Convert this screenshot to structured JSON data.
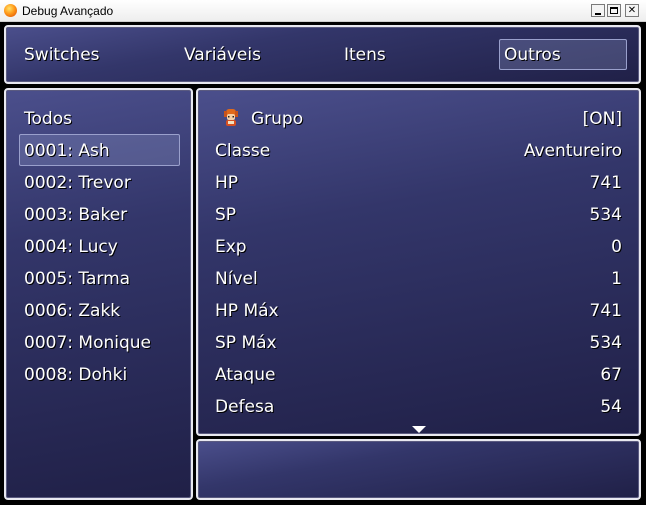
{
  "window": {
    "title": "Debug Avançado"
  },
  "menu": {
    "items": [
      "Switches",
      "Variáveis",
      "Itens",
      "Outros"
    ],
    "selected": "Outros"
  },
  "sidebar": {
    "items": [
      "Todos",
      "0001: Ash",
      "0002: Trevor",
      "0003: Baker",
      "0004: Lucy",
      "0005: Tarma",
      "0006: Zakk",
      "0007: Monique",
      "0008: Dohki"
    ],
    "selected": "0001: Ash"
  },
  "detail": {
    "group": {
      "label": "Grupo",
      "value": "[ON]"
    },
    "rows": [
      {
        "label": "Classe",
        "value": "Aventureiro"
      },
      {
        "label": "HP",
        "value": "741"
      },
      {
        "label": "SP",
        "value": "534"
      },
      {
        "label": "Exp",
        "value": "0"
      },
      {
        "label": "Nível",
        "value": "1"
      },
      {
        "label": "HP Máx",
        "value": "741"
      },
      {
        "label": "SP Máx",
        "value": "534"
      },
      {
        "label": "Ataque",
        "value": "67"
      },
      {
        "label": "Defesa",
        "value": "54"
      }
    ]
  },
  "help": {
    "text": ""
  },
  "icons": [
    "app-icon",
    "minimize-icon",
    "maximize-icon",
    "close-icon",
    "actor-sprite-icon",
    "scroll-down-arrow-icon"
  ]
}
